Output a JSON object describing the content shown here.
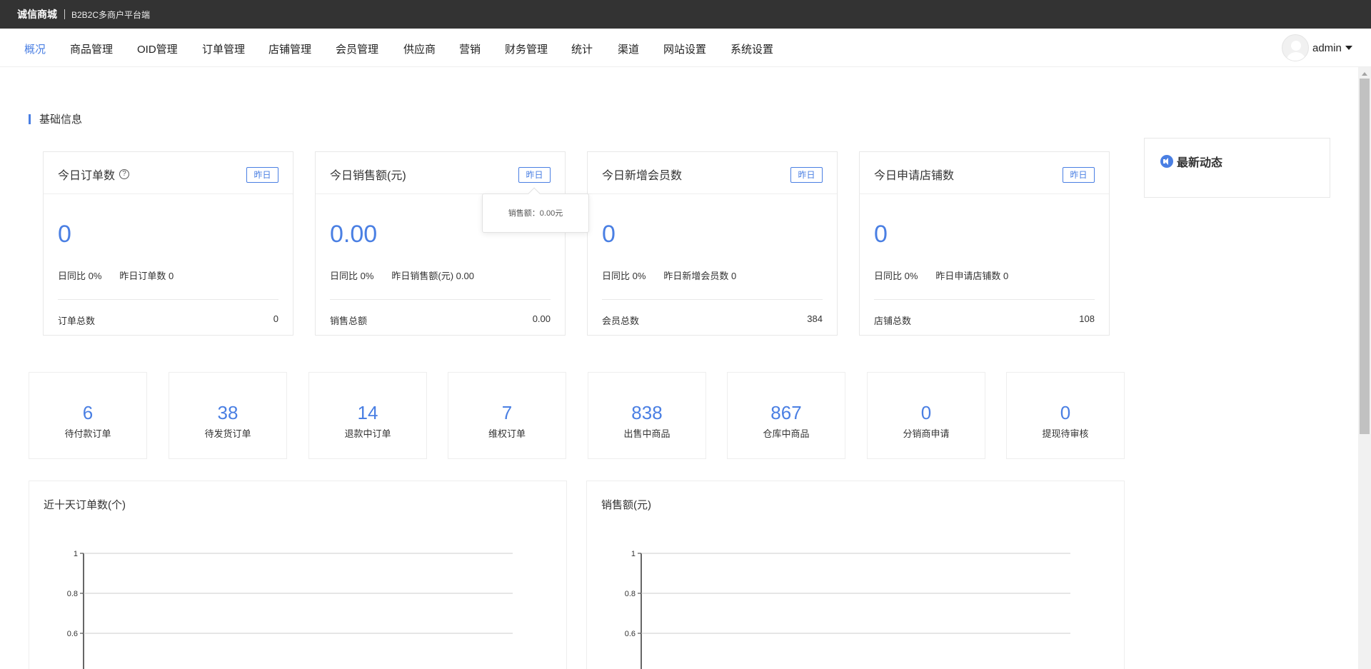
{
  "app": {
    "brand": "诚信商城",
    "subtitle": "B2B2C多商户平台端"
  },
  "nav": {
    "items": [
      "概况",
      "商品管理",
      "OID管理",
      "订单管理",
      "店铺管理",
      "会员管理",
      "供应商",
      "营销",
      "财务管理",
      "统计",
      "渠道",
      "网站设置",
      "系统设置"
    ],
    "active": "概况",
    "user": "admin"
  },
  "section": {
    "title": "基础信息"
  },
  "cards": [
    {
      "title": "今日订单数",
      "has_help": true,
      "yesterday_btn": "昨日",
      "value": "0",
      "ratio": "日同比 0%",
      "yesterday": "昨日订单数 0",
      "total_label": "订单总数",
      "total_value": "0"
    },
    {
      "title": "今日销售额(元)",
      "has_help": false,
      "yesterday_btn": "昨日",
      "value": "0.00",
      "ratio": "日同比 0%",
      "yesterday": "昨日销售额(元) 0.00",
      "total_label": "销售总额",
      "total_value": "0.00"
    },
    {
      "title": "今日新增会员数",
      "has_help": false,
      "yesterday_btn": "昨日",
      "value": "0",
      "ratio": "日同比 0%",
      "yesterday": "昨日新增会员数 0",
      "total_label": "会员总数",
      "total_value": "384"
    },
    {
      "title": "今日申请店铺数",
      "has_help": false,
      "yesterday_btn": "昨日",
      "value": "0",
      "ratio": "日同比 0%",
      "yesterday": "昨日申请店铺数 0",
      "total_label": "店铺总数",
      "total_value": "108"
    }
  ],
  "tooltip": {
    "text": "销售额：0.00元"
  },
  "news": {
    "title": "最新动态"
  },
  "stats": [
    {
      "value": "6",
      "label": "待付款订单"
    },
    {
      "value": "38",
      "label": "待发货订单"
    },
    {
      "value": "14",
      "label": "退款中订单"
    },
    {
      "value": "7",
      "label": "维权订单"
    },
    {
      "value": "838",
      "label": "出售中商品"
    },
    {
      "value": "867",
      "label": "仓库中商品"
    },
    {
      "value": "0",
      "label": "分销商申请"
    },
    {
      "value": "0",
      "label": "提现待审核"
    }
  ],
  "chart_data": [
    {
      "type": "line",
      "title": "近十天订单数(个)",
      "y_ticks": [
        "1",
        "0.8",
        "0.6"
      ],
      "ylim": [
        0,
        1
      ],
      "grid": true,
      "series": []
    },
    {
      "type": "line",
      "title": "销售额(元)",
      "y_ticks": [
        "1",
        "0.8",
        "0.6"
      ],
      "ylim": [
        0,
        1
      ],
      "grid": true,
      "series": []
    }
  ],
  "colors": {
    "accent": "#4a7fe3",
    "topbar": "#333333"
  }
}
